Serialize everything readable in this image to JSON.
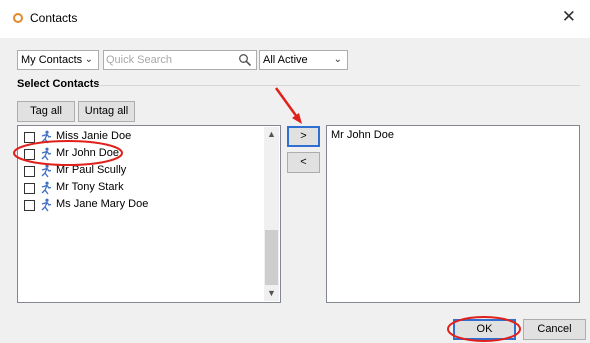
{
  "window": {
    "title": "Contacts",
    "close_glyph": "✕"
  },
  "filters": {
    "list_select": "My Contacts",
    "search_placeholder": "Quick Search",
    "status_select": "All Active"
  },
  "group": {
    "title": "Select Contacts"
  },
  "buttons": {
    "tag_all": "Tag all",
    "untag_all": "Untag all",
    "move_right": ">",
    "move_left": "<",
    "ok": "OK",
    "cancel": "Cancel"
  },
  "available_contacts": [
    {
      "label": "Miss Janie Doe",
      "checked": false
    },
    {
      "label": "Mr John Doe",
      "checked": false
    },
    {
      "label": "Mr Paul Scully",
      "checked": false
    },
    {
      "label": "Mr Tony Stark",
      "checked": false
    },
    {
      "label": "Ms Jane Mary Doe",
      "checked": false
    }
  ],
  "selected_contacts": [
    "Mr John Doe"
  ],
  "icons": {
    "window": "app-logo-icon",
    "search": "magnifier-icon",
    "contact": "person-icon",
    "dropdown": "chevron-down-icon"
  },
  "colors": {
    "annotation": "#e0201b",
    "person_icon": "#3f6fc4",
    "app_logo": "#e08a2c"
  }
}
